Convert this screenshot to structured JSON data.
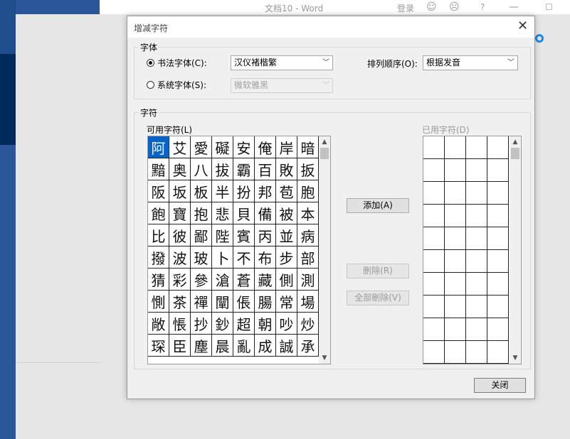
{
  "word": {
    "title": "文档10  -  Word",
    "login": "登录",
    "icons": [
      "smile-icon",
      "frown-icon",
      "help-icon",
      "minimize-icon",
      "maximize-icon"
    ]
  },
  "dialog": {
    "title": "增减字符",
    "close_glyph": "✕",
    "font_group": {
      "label": "字体",
      "calligraphy_radio": "书法字体(C):",
      "system_radio": "系统字体(S):",
      "calligraphy_font": "汉仪褚楷繁",
      "system_font": "微软雅黑",
      "sort_label": "排列顺序(O):",
      "sort_value": "根据发音",
      "calligraphy_selected": true
    },
    "chars_group": {
      "label": "字符",
      "available_label": "可用字符(L)",
      "used_label": "已用字符(D)",
      "available_chars": [
        "阿",
        "艾",
        "愛",
        "礙",
        "安",
        "俺",
        "岸",
        "暗",
        "黯",
        "奥",
        "八",
        "拔",
        "霸",
        "百",
        "敗",
        "扳",
        "阪",
        "坂",
        "板",
        "半",
        "扮",
        "邦",
        "苞",
        "胞",
        "飽",
        "寶",
        "抱",
        "悲",
        "貝",
        "備",
        "被",
        "本",
        "比",
        "彼",
        "鄙",
        "陛",
        "賓",
        "丙",
        "並",
        "病",
        "撥",
        "波",
        "玻",
        "卜",
        "不",
        "布",
        "步",
        "部",
        "猜",
        "彩",
        "參",
        "滄",
        "蒼",
        "藏",
        "側",
        "測",
        "惻",
        "茶",
        "禪",
        "闡",
        "倀",
        "腸",
        "常",
        "場",
        "敞",
        "悵",
        "抄",
        "鈔",
        "超",
        "朝",
        "吵",
        "炒",
        "琛",
        "臣",
        "塵",
        "晨",
        "亂",
        "成",
        "誠",
        "承"
      ],
      "used_chars": [],
      "add_button": "添加(A)",
      "remove_button": "刪除(R)",
      "remove_all_button": "全部刪除(V)"
    },
    "close_button": "关闭"
  }
}
